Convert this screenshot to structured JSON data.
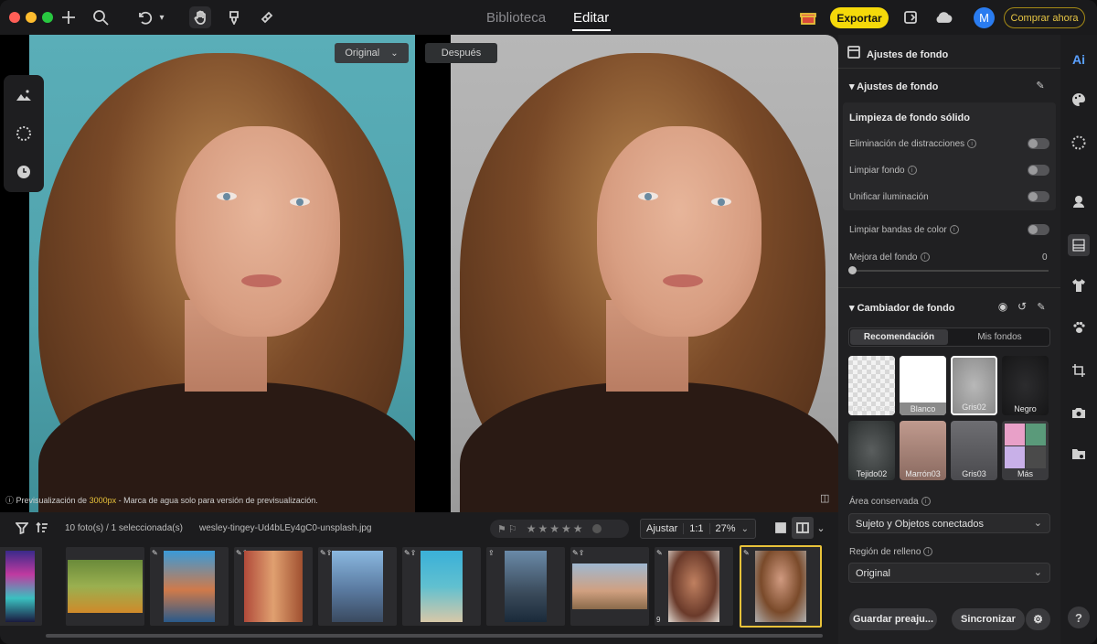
{
  "header": {
    "nav_tabs": [
      {
        "label": "Biblioteca"
      },
      {
        "label": "Editar"
      }
    ],
    "export_label": "Exportar",
    "avatar_initial": "M",
    "buy_label": "Comprar ahora"
  },
  "canvas": {
    "before_select": "Original",
    "after_label": "Después",
    "notice_prefix": "Previsualización de ",
    "notice_size": "3000px",
    "notice_suffix": " - Marca de agua solo para versión de previsualización."
  },
  "filmstrip": {
    "count_label": "10 foto(s) / 1 seleccionada(s)",
    "filename": "wesley-tingey-Ud4bLEy4gC0-unsplash.jpg",
    "fit_label": "Ajustar",
    "one_to_one": "1:1",
    "zoom": "27%",
    "thumb_badge_count": "9"
  },
  "panel": {
    "section_title": "Ajustes de fondo",
    "subsection_title": "Ajustes de fondo",
    "cleanup_title": "Limpieza de fondo sólido",
    "toggles": [
      {
        "label": "Eliminación de distracciones",
        "info": true
      },
      {
        "label": "Limpiar fondo",
        "info": true
      },
      {
        "label": "Unificar iluminación",
        "info": false
      },
      {
        "label": "Limpiar bandas de color",
        "info": true
      }
    ],
    "enhance_label": "Mejora del fondo",
    "enhance_value": "0",
    "changer_title": "Cambiador de fondo",
    "seg_tabs": [
      {
        "label": "Recomendación"
      },
      {
        "label": "Mis fondos"
      }
    ],
    "swatches": [
      {
        "label": "Trans...rente"
      },
      {
        "label": "Blanco"
      },
      {
        "label": "Gris02"
      },
      {
        "label": "Negro"
      },
      {
        "label": "Tejido02"
      },
      {
        "label": "Marrón03"
      },
      {
        "label": "Gris03"
      },
      {
        "label": "Más"
      }
    ],
    "preserved_area_label": "Área conservada",
    "preserved_area_value": "Sujeto y Objetos conectados",
    "fill_region_label": "Región de relleno",
    "fill_region_value": "Original",
    "save_preset_label": "Guardar preaju...",
    "sync_label": "Sincronizar"
  },
  "rail": {
    "ai_label": "Ai",
    "help_label": "?"
  },
  "colors": {
    "accent": "#f5d90a",
    "avatar": "#2a7cf0",
    "before_bg": "#55a8b2",
    "after_bg": "#b0b0b0"
  }
}
